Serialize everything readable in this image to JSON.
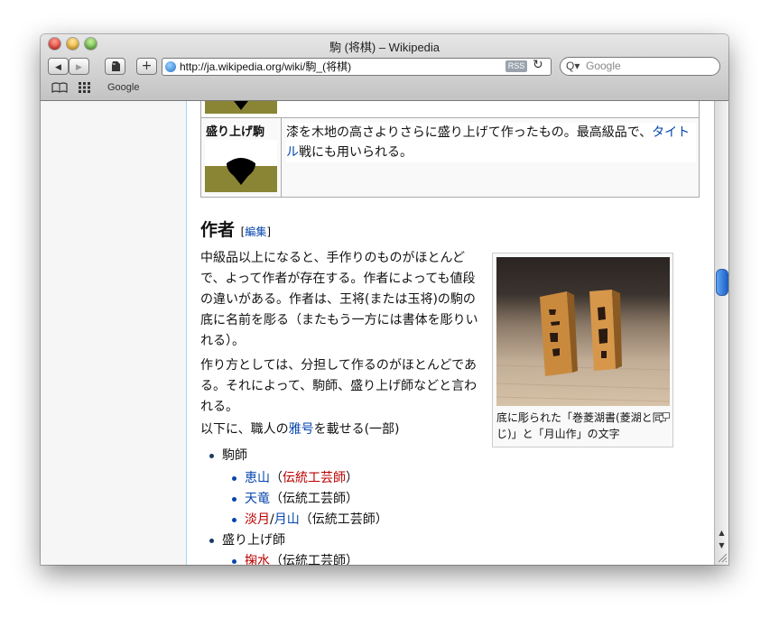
{
  "window": {
    "title": "駒 (将棋) – Wikipedia",
    "url": "http://ja.wikipedia.org/wiki/駒_(将棋)",
    "rss_label": "RSS",
    "search_placeholder": "Google",
    "bookmarks": [
      "Google"
    ]
  },
  "nav": {
    "back_icon": "◀",
    "forward_icon": "▶",
    "add_icon": "+",
    "reload_icon": "↻"
  },
  "table": {
    "row_name": "盛り上げ駒",
    "desc_part1": "漆を木地の高さよりさらに盛り上げて作ったもの。最高級品で、",
    "desc_link": "タイトル",
    "desc_part2": "戦にも用いられる。"
  },
  "section": {
    "heading": "作者",
    "edit_open": "[",
    "edit_label": "編集",
    "edit_close": "]",
    "para1": "中級品以上になると、手作りのものがほとんどで、よって作者が存在する。作者によっても値段の違いがある。作者は、王将(または玉将)の駒の底に名前を彫る（またもう一方には書体を彫りいれる）。",
    "para2": "作り方としては、分担して作るのがほとんどである。それによって、駒師、盛り上げ師などと言われる。",
    "para3_pre": "以下に、職人の",
    "para3_link": "雅号",
    "para3_post": "を載せる(一部)"
  },
  "thumb": {
    "caption": "底に彫られた「巻菱湖書(菱湖と同じ)」と「月山作」の文字"
  },
  "list": {
    "group1": "駒師",
    "item1_link": "恵山",
    "item1_open": "（",
    "item1_red": "伝統工芸師",
    "item1_close": "）",
    "item2_link": "天竜",
    "item2_rest": "（伝統工芸師）",
    "item3_red": "淡月",
    "item3_sep": "/",
    "item3_link": "月山",
    "item3_rest": "（伝統工芸師）",
    "group2": "盛り上げ師",
    "item4_red": "掬水",
    "item4_rest": "（伝統工芸師）"
  },
  "colors": {
    "link": "#0645ad",
    "redlink": "#ba0000",
    "scroll_thumb": "#1c5fc6"
  }
}
